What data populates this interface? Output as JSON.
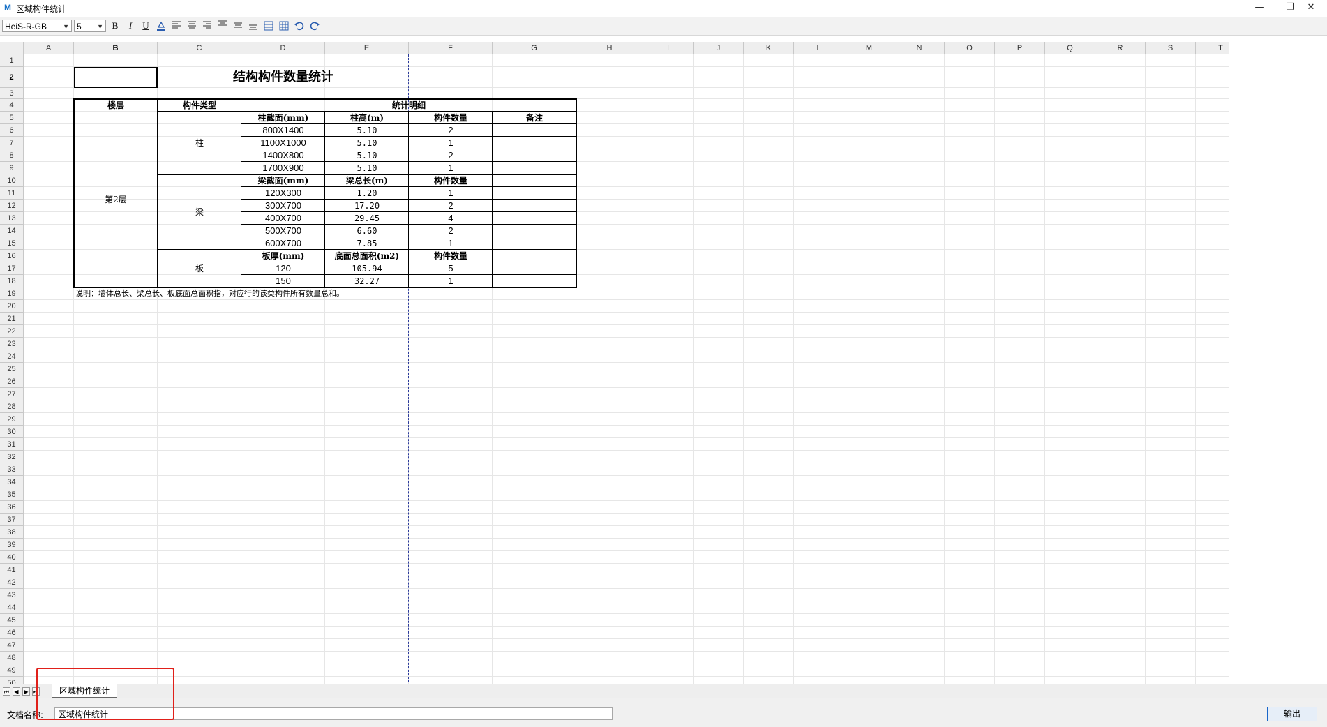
{
  "window": {
    "title": "区域构件统计",
    "controls": {
      "minimize": "—",
      "restore": "❐",
      "close": "✕"
    }
  },
  "toolbar": {
    "font_name": "HeiS-R-GB",
    "font_size": "5",
    "bold": "B",
    "italic": "I",
    "underline": "U"
  },
  "sheet": {
    "columns": [
      "A",
      "B",
      "C",
      "D",
      "E",
      "F",
      "G",
      "H",
      "I",
      "J",
      "K",
      "L",
      "M",
      "N",
      "O",
      "P",
      "Q",
      "R",
      "S",
      "T"
    ],
    "active_column": "B",
    "active_row": "2",
    "title": "结构构件数量统计",
    "headers": {
      "floor": "楼层",
      "component_type": "构件类型",
      "details": "统计明细",
      "remark": "备注"
    },
    "floor": "第2层",
    "groups": [
      {
        "type": "柱",
        "col_headers": [
          "柱截面(mm)",
          "柱高(m)",
          "构件数量"
        ],
        "rows": [
          [
            "800X1400",
            "5.10",
            "2"
          ],
          [
            "1100X1000",
            "5.10",
            "1"
          ],
          [
            "1400X800",
            "5.10",
            "2"
          ],
          [
            "1700X900",
            "5.10",
            "1"
          ]
        ]
      },
      {
        "type": "梁",
        "col_headers": [
          "梁截面(mm)",
          "梁总长(m)",
          "构件数量"
        ],
        "rows": [
          [
            "120X300",
            "1.20",
            "1"
          ],
          [
            "300X700",
            "17.20",
            "2"
          ],
          [
            "400X700",
            "29.45",
            "4"
          ],
          [
            "500X700",
            "6.60",
            "2"
          ],
          [
            "600X700",
            "7.85",
            "1"
          ]
        ]
      },
      {
        "type": "板",
        "col_headers": [
          "板厚(mm)",
          "底面总面积(m2)",
          "构件数量"
        ],
        "rows": [
          [
            "120",
            "105.94",
            "5"
          ],
          [
            "150",
            "32.27",
            "1"
          ]
        ]
      }
    ],
    "note": "说明：墙体总长、梁总长、板底面总面积指，对应行的该类构件所有数量总和。"
  },
  "tabs": {
    "sheet_tab": "区域构件统计",
    "nav": [
      "⏮",
      "◀",
      "▶",
      "⏭"
    ]
  },
  "status": {
    "doc_label": "文档名称:",
    "doc_name": "区域构件统计",
    "export_button": "输出"
  }
}
